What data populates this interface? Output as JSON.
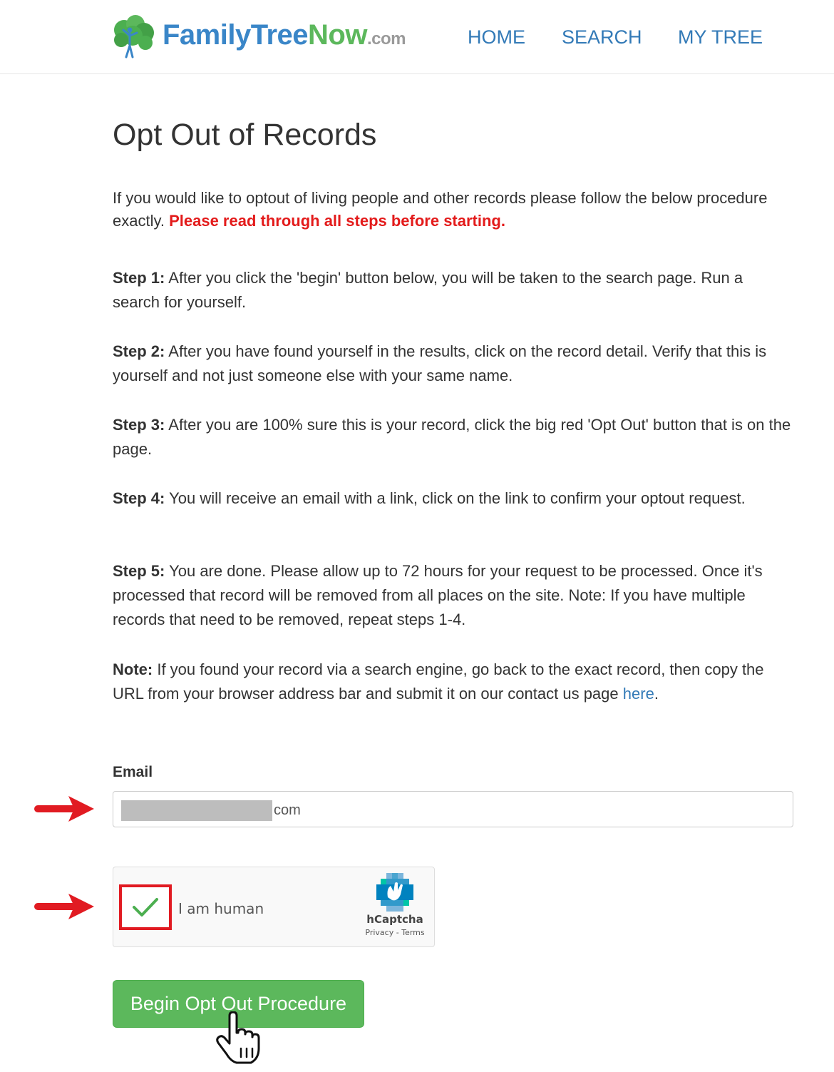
{
  "header": {
    "logo": {
      "part1": "FamilyTree",
      "part2": "Now",
      "part3": ".com",
      "icon": "tree-logo-icon"
    },
    "nav": {
      "home": "HOME",
      "search": "SEARCH",
      "my_tree": "MY TREE"
    }
  },
  "main": {
    "title": "Opt Out of Records",
    "intro": "If you would like to optout of living people and other records please follow the below procedure exactly.",
    "intro_warning": "Please read through all steps before starting.",
    "steps": [
      {
        "label": "Step 1:",
        "text": "After you click the 'begin' button below, you will be taken to the search page. Run a search for yourself."
      },
      {
        "label": "Step 2:",
        "text": "After you have found yourself in the results, click on the record detail. Verify that this is yourself and not just someone else with your same name."
      },
      {
        "label": "Step 3:",
        "text": "After you are 100% sure this is your record, click the big red 'Opt Out' button that is on the page."
      },
      {
        "label": "Step 4:",
        "text": "You will receive an email with a link, click on the link to confirm your optout request."
      },
      {
        "label": "Step 5:",
        "text": "You are done. Please allow up to 72 hours for your request to be processed. Once it's processed that record will be removed from all places on the site. Note: If you have multiple records that need to be removed, repeat steps 1-4."
      }
    ],
    "note": {
      "label": "Note:",
      "text": "If you found your record via a search engine, go back to the exact record, then copy the URL from your browser address bar and submit it on our contact us page",
      "link": "here",
      "end": "."
    },
    "email": {
      "label": "Email",
      "value_visible": "com"
    },
    "captcha": {
      "checked": true,
      "label": "I am human",
      "brand": "hCaptcha",
      "links": "Privacy - Terms"
    },
    "begin_button": "Begin Opt Out Procedure"
  },
  "colors": {
    "brand_blue": "#3a86c8",
    "brand_green": "#5cb85c",
    "warning_red": "#e31b1b",
    "link_blue": "#337ab7",
    "annotation_red": "#e11b22"
  }
}
